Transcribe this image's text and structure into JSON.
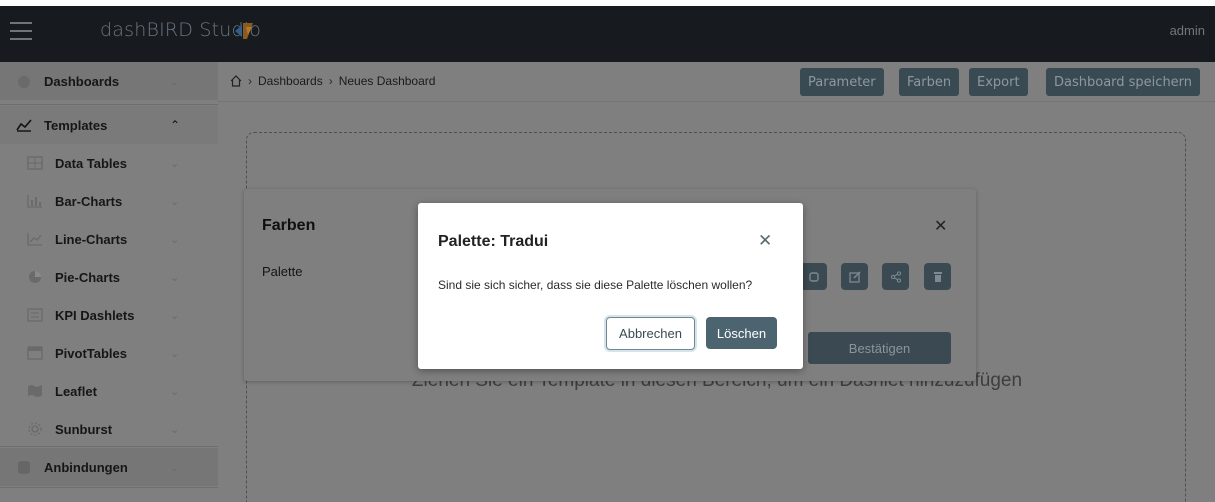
{
  "app": {
    "brand": "dashBIRD Studio",
    "user": "admin"
  },
  "sidebar": {
    "items": [
      {
        "label": "Dashboards",
        "icon": "dashboard-icon",
        "kind": "section"
      },
      {
        "label": "Templates",
        "icon": "line-chart-icon",
        "kind": "open"
      },
      {
        "label": "Data Tables",
        "icon": "table-icon",
        "kind": "sub"
      },
      {
        "label": "Bar-Charts",
        "icon": "bar-chart-icon",
        "kind": "sub"
      },
      {
        "label": "Line-Charts",
        "icon": "line-chart-icon",
        "kind": "sub"
      },
      {
        "label": "Pie-Charts",
        "icon": "pie-chart-icon",
        "kind": "sub"
      },
      {
        "label": "KPI Dashlets",
        "icon": "kpi-icon",
        "kind": "sub"
      },
      {
        "label": "PivotTables",
        "icon": "pivot-table-icon",
        "kind": "sub"
      },
      {
        "label": "Leaflet",
        "icon": "map-icon",
        "kind": "sub"
      },
      {
        "label": "Sunburst",
        "icon": "sunburst-icon",
        "kind": "sub"
      },
      {
        "label": "Anbindungen",
        "icon": "database-icon",
        "kind": "section"
      }
    ]
  },
  "breadcrumb": {
    "items": [
      "Dashboards",
      "Neues Dashboard"
    ]
  },
  "toolbar": {
    "parameter": "Parameter",
    "farben": "Farben",
    "export": "Export",
    "save": "Dashboard speichern"
  },
  "dropzone": {
    "text": "Ziehen Sie ein Template in diesen Bereich, um ein Dashlet hinzuzufügen"
  },
  "farben_dialog": {
    "title": "Farben",
    "palette_label": "Palette",
    "confirm": "Bestätigen"
  },
  "confirm_modal": {
    "title": "Palette: Tradui",
    "body": "Sind sie sich sicher, dass sie diese Palette löschen wollen?",
    "cancel": "Abbrechen",
    "delete": "Löschen"
  },
  "colors": {
    "primary": "#4b6470",
    "topbar": "#171b1f",
    "overlay_gray": "#7f7f7f"
  }
}
